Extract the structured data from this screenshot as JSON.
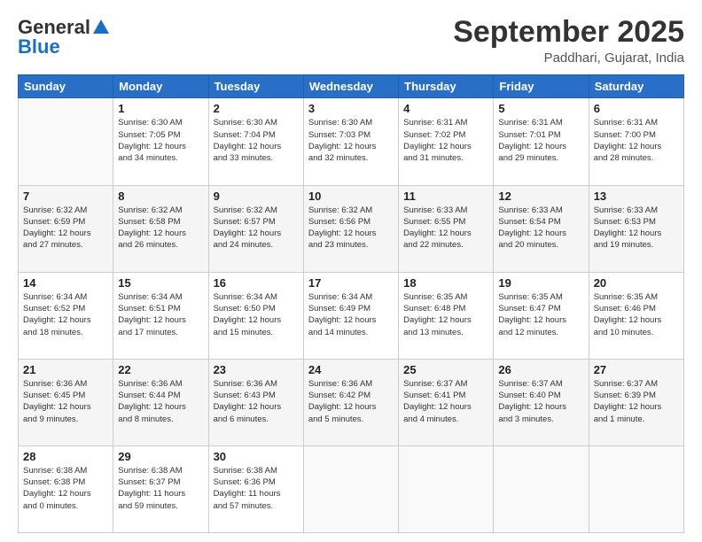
{
  "header": {
    "logo_general": "General",
    "logo_blue": "Blue",
    "month": "September 2025",
    "location": "Paddhari, Gujarat, India"
  },
  "weekdays": [
    "Sunday",
    "Monday",
    "Tuesday",
    "Wednesday",
    "Thursday",
    "Friday",
    "Saturday"
  ],
  "weeks": [
    [
      {
        "day": "",
        "info": ""
      },
      {
        "day": "1",
        "info": "Sunrise: 6:30 AM\nSunset: 7:05 PM\nDaylight: 12 hours\nand 34 minutes."
      },
      {
        "day": "2",
        "info": "Sunrise: 6:30 AM\nSunset: 7:04 PM\nDaylight: 12 hours\nand 33 minutes."
      },
      {
        "day": "3",
        "info": "Sunrise: 6:30 AM\nSunset: 7:03 PM\nDaylight: 12 hours\nand 32 minutes."
      },
      {
        "day": "4",
        "info": "Sunrise: 6:31 AM\nSunset: 7:02 PM\nDaylight: 12 hours\nand 31 minutes."
      },
      {
        "day": "5",
        "info": "Sunrise: 6:31 AM\nSunset: 7:01 PM\nDaylight: 12 hours\nand 29 minutes."
      },
      {
        "day": "6",
        "info": "Sunrise: 6:31 AM\nSunset: 7:00 PM\nDaylight: 12 hours\nand 28 minutes."
      }
    ],
    [
      {
        "day": "7",
        "info": "Sunrise: 6:32 AM\nSunset: 6:59 PM\nDaylight: 12 hours\nand 27 minutes."
      },
      {
        "day": "8",
        "info": "Sunrise: 6:32 AM\nSunset: 6:58 PM\nDaylight: 12 hours\nand 26 minutes."
      },
      {
        "day": "9",
        "info": "Sunrise: 6:32 AM\nSunset: 6:57 PM\nDaylight: 12 hours\nand 24 minutes."
      },
      {
        "day": "10",
        "info": "Sunrise: 6:32 AM\nSunset: 6:56 PM\nDaylight: 12 hours\nand 23 minutes."
      },
      {
        "day": "11",
        "info": "Sunrise: 6:33 AM\nSunset: 6:55 PM\nDaylight: 12 hours\nand 22 minutes."
      },
      {
        "day": "12",
        "info": "Sunrise: 6:33 AM\nSunset: 6:54 PM\nDaylight: 12 hours\nand 20 minutes."
      },
      {
        "day": "13",
        "info": "Sunrise: 6:33 AM\nSunset: 6:53 PM\nDaylight: 12 hours\nand 19 minutes."
      }
    ],
    [
      {
        "day": "14",
        "info": "Sunrise: 6:34 AM\nSunset: 6:52 PM\nDaylight: 12 hours\nand 18 minutes."
      },
      {
        "day": "15",
        "info": "Sunrise: 6:34 AM\nSunset: 6:51 PM\nDaylight: 12 hours\nand 17 minutes."
      },
      {
        "day": "16",
        "info": "Sunrise: 6:34 AM\nSunset: 6:50 PM\nDaylight: 12 hours\nand 15 minutes."
      },
      {
        "day": "17",
        "info": "Sunrise: 6:34 AM\nSunset: 6:49 PM\nDaylight: 12 hours\nand 14 minutes."
      },
      {
        "day": "18",
        "info": "Sunrise: 6:35 AM\nSunset: 6:48 PM\nDaylight: 12 hours\nand 13 minutes."
      },
      {
        "day": "19",
        "info": "Sunrise: 6:35 AM\nSunset: 6:47 PM\nDaylight: 12 hours\nand 12 minutes."
      },
      {
        "day": "20",
        "info": "Sunrise: 6:35 AM\nSunset: 6:46 PM\nDaylight: 12 hours\nand 10 minutes."
      }
    ],
    [
      {
        "day": "21",
        "info": "Sunrise: 6:36 AM\nSunset: 6:45 PM\nDaylight: 12 hours\nand 9 minutes."
      },
      {
        "day": "22",
        "info": "Sunrise: 6:36 AM\nSunset: 6:44 PM\nDaylight: 12 hours\nand 8 minutes."
      },
      {
        "day": "23",
        "info": "Sunrise: 6:36 AM\nSunset: 6:43 PM\nDaylight: 12 hours\nand 6 minutes."
      },
      {
        "day": "24",
        "info": "Sunrise: 6:36 AM\nSunset: 6:42 PM\nDaylight: 12 hours\nand 5 minutes."
      },
      {
        "day": "25",
        "info": "Sunrise: 6:37 AM\nSunset: 6:41 PM\nDaylight: 12 hours\nand 4 minutes."
      },
      {
        "day": "26",
        "info": "Sunrise: 6:37 AM\nSunset: 6:40 PM\nDaylight: 12 hours\nand 3 minutes."
      },
      {
        "day": "27",
        "info": "Sunrise: 6:37 AM\nSunset: 6:39 PM\nDaylight: 12 hours\nand 1 minute."
      }
    ],
    [
      {
        "day": "28",
        "info": "Sunrise: 6:38 AM\nSunset: 6:38 PM\nDaylight: 12 hours\nand 0 minutes."
      },
      {
        "day": "29",
        "info": "Sunrise: 6:38 AM\nSunset: 6:37 PM\nDaylight: 11 hours\nand 59 minutes."
      },
      {
        "day": "30",
        "info": "Sunrise: 6:38 AM\nSunset: 6:36 PM\nDaylight: 11 hours\nand 57 minutes."
      },
      {
        "day": "",
        "info": ""
      },
      {
        "day": "",
        "info": ""
      },
      {
        "day": "",
        "info": ""
      },
      {
        "day": "",
        "info": ""
      }
    ]
  ]
}
